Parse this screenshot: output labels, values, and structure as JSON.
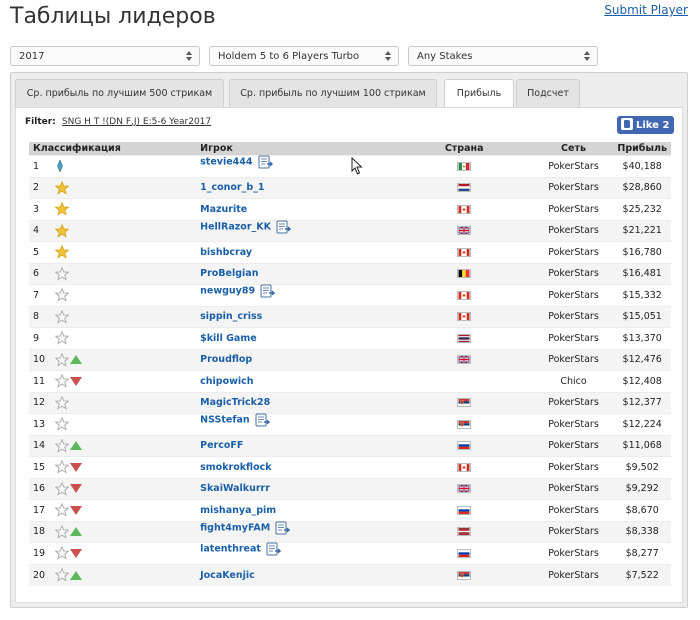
{
  "header": {
    "title": "Таблицы лидеров",
    "submit_link": "Submit Player"
  },
  "selects": {
    "year": "2017",
    "game": "Holdem 5 to 6 Players Turbo",
    "stakes": "Any Stakes"
  },
  "tabs": [
    {
      "label": "Ср. прибыль по лучшим 500 стрикам",
      "active": false
    },
    {
      "label": "Ср. прибыль по лучшим 100 стрикам",
      "active": false
    },
    {
      "label": "Прибыль",
      "active": true
    },
    {
      "label": "Подсчет",
      "active": false
    }
  ],
  "filter": {
    "label": "Filter:",
    "value": "SNG H T !(DN F,J) E:5-6 Year2017"
  },
  "like_button": {
    "label": "Like 2"
  },
  "table": {
    "headers": [
      "Классификация",
      "Игрок",
      "Страна",
      "Сеть",
      "Прибыль"
    ],
    "rows": [
      {
        "rank": "1",
        "star": "crown",
        "trend": "",
        "player": "stevie444",
        "notes": true,
        "flag": "mx",
        "network": "PokerStars",
        "profit": "$40,188"
      },
      {
        "rank": "2",
        "star": "gold",
        "trend": "",
        "player": "1_conor_b_1",
        "notes": false,
        "flag": "nl",
        "network": "PokerStars",
        "profit": "$28,860"
      },
      {
        "rank": "3",
        "star": "gold",
        "trend": "",
        "player": "Mazurite",
        "notes": false,
        "flag": "ca",
        "network": "PokerStars",
        "profit": "$25,232"
      },
      {
        "rank": "4",
        "star": "gold",
        "trend": "",
        "player": "HellRazor_KK",
        "notes": true,
        "flag": "gb",
        "network": "PokerStars",
        "profit": "$21,221"
      },
      {
        "rank": "5",
        "star": "gold",
        "trend": "",
        "player": "bishbcray",
        "notes": false,
        "flag": "ca",
        "network": "PokerStars",
        "profit": "$16,780"
      },
      {
        "rank": "6",
        "star": "grey",
        "trend": "",
        "player": "ProBelgian",
        "notes": false,
        "flag": "be",
        "network": "PokerStars",
        "profit": "$16,481"
      },
      {
        "rank": "7",
        "star": "grey",
        "trend": "",
        "player": "newguy89",
        "notes": true,
        "flag": "ca",
        "network": "PokerStars",
        "profit": "$15,332"
      },
      {
        "rank": "8",
        "star": "grey",
        "trend": "",
        "player": "sippin_criss",
        "notes": false,
        "flag": "ca",
        "network": "PokerStars",
        "profit": "$15,051"
      },
      {
        "rank": "9",
        "star": "grey",
        "trend": "",
        "player": "$kill Game",
        "notes": false,
        "flag": "th",
        "network": "PokerStars",
        "profit": "$13,370"
      },
      {
        "rank": "10",
        "star": "grey",
        "trend": "up",
        "player": "Proudflop",
        "notes": false,
        "flag": "gb",
        "network": "PokerStars",
        "profit": "$12,476"
      },
      {
        "rank": "11",
        "star": "grey",
        "trend": "down",
        "player": "chipowich",
        "notes": false,
        "flag": "",
        "network": "Chico",
        "profit": "$12,408"
      },
      {
        "rank": "12",
        "star": "grey",
        "trend": "",
        "player": "MagicTrick28",
        "notes": false,
        "flag": "rs",
        "network": "PokerStars",
        "profit": "$12,377"
      },
      {
        "rank": "13",
        "star": "grey",
        "trend": "",
        "player": "NSStefan",
        "notes": true,
        "flag": "rs",
        "network": "PokerStars",
        "profit": "$12,224"
      },
      {
        "rank": "14",
        "star": "grey",
        "trend": "up",
        "player": "PercoFF",
        "notes": false,
        "flag": "ru",
        "network": "PokerStars",
        "profit": "$11,068"
      },
      {
        "rank": "15",
        "star": "grey",
        "trend": "down",
        "player": "smokrokflock",
        "notes": false,
        "flag": "ca",
        "network": "PokerStars",
        "profit": "$9,502"
      },
      {
        "rank": "16",
        "star": "grey",
        "trend": "down",
        "player": "SkaiWalkurrr",
        "notes": false,
        "flag": "gb",
        "network": "PokerStars",
        "profit": "$9,292"
      },
      {
        "rank": "17",
        "star": "grey",
        "trend": "down",
        "player": "mishanya_pim",
        "notes": false,
        "flag": "ru",
        "network": "PokerStars",
        "profit": "$8,670"
      },
      {
        "rank": "18",
        "star": "grey",
        "trend": "up",
        "player": "fight4myFAM",
        "notes": true,
        "flag": "lv",
        "network": "PokerStars",
        "profit": "$8,338"
      },
      {
        "rank": "19",
        "star": "grey",
        "trend": "down",
        "player": "latenthreat",
        "notes": true,
        "flag": "ru",
        "network": "PokerStars",
        "profit": "$8,277"
      },
      {
        "rank": "20",
        "star": "grey",
        "trend": "up",
        "player": "JocaKenjic",
        "notes": false,
        "flag": "rs",
        "network": "PokerStars",
        "profit": "$7,522"
      }
    ]
  },
  "colors": {
    "link": "#1a5fa8",
    "star_gold": "#f0c23a",
    "star_grey": "#c8c8c8",
    "trend_up": "#5cb85c",
    "trend_down": "#c9524f",
    "like_bg": "#4267b2",
    "header_row": "#d4d4d4"
  }
}
